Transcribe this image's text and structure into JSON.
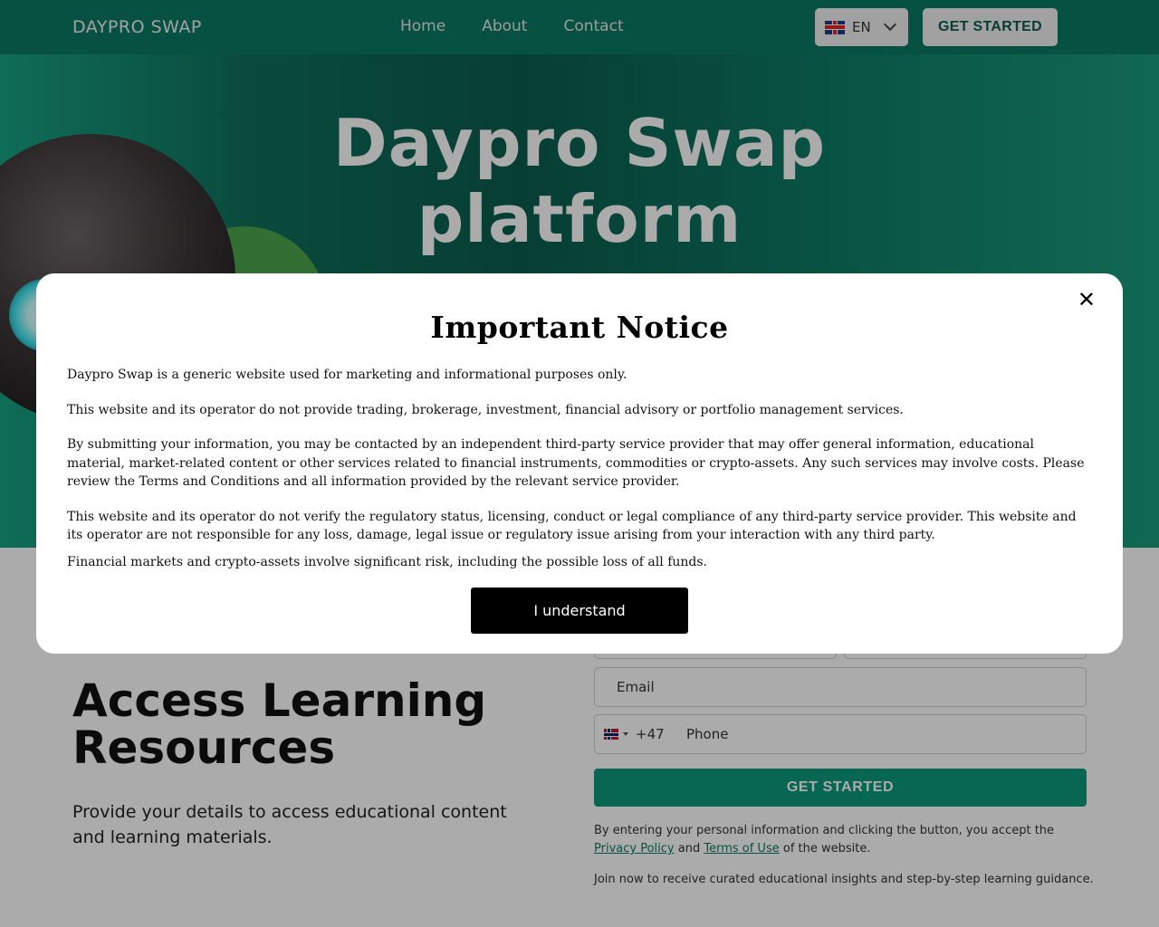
{
  "nav": {
    "brand": "DAYPRO SWAP",
    "links": [
      "Home",
      "About",
      "Contact"
    ],
    "language": "EN",
    "cta": "GET STARTED"
  },
  "hero": {
    "title_line1": "Daypro Swap",
    "title_line2": "platform"
  },
  "section": {
    "heading_line1": "Access Learning",
    "heading_line2": "Resources",
    "lead": "Provide your details to access educational content and learning materials."
  },
  "form": {
    "email_placeholder": "Email",
    "dial_code": "+47",
    "phone_placeholder": "Phone",
    "submit": "GET STARTED",
    "legal_prefix": "By entering your personal information and clicking the button, you accept the",
    "privacy_link": "Privacy Policy",
    "legal_and": "and",
    "terms_link": "Terms of Use",
    "legal_suffix": "of the website.",
    "join_text": "Join now to receive curated educational insights and step-by-step learning guidance."
  },
  "modal": {
    "close_glyph": "✕",
    "title": "Important Notice",
    "p1": "Daypro Swap is a generic website used for marketing and informational purposes only.",
    "p2": "This website and its operator do not provide trading, brokerage, investment, financial advisory or portfolio management services.",
    "p3": "By submitting your information, you may be contacted by an independent third-party service provider that may offer general information, educational material, market-related content or other services related to financial instruments, commodities or crypto-assets. Any such services may involve costs. Please review the Terms and Conditions and all information provided by the relevant service provider.",
    "p4": "This website and its operator do not verify the regulatory status, licensing, conduct or legal compliance of any third-party service provider. This website and its operator are not responsible for any loss, damage, legal issue or regulatory issue arising from your interaction with any third party.",
    "p5": "Financial markets and crypto-assets involve significant risk, including the possible loss of all funds.",
    "button": "I understand"
  },
  "colors": {
    "brand_green": "#0a7a63",
    "button_green": "#0d9a7c",
    "modal_button": "#000000"
  }
}
